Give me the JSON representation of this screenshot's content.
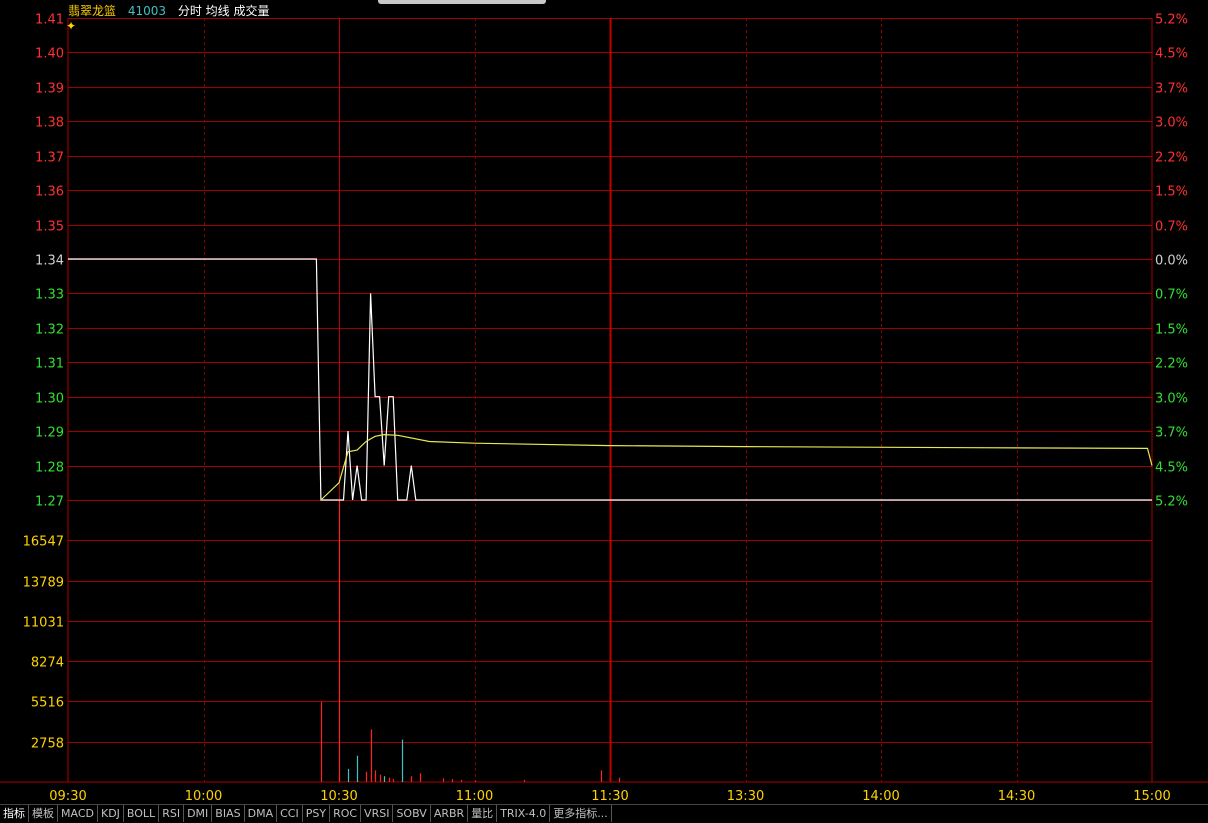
{
  "header": {
    "name": "翡翠龙篮",
    "code": "41003",
    "labels": "分时 均线 成交量",
    "name_color": "#ffd200",
    "code_color": "#40c0c0",
    "labels_color": "#ffffff"
  },
  "chart_data": {
    "type": "line",
    "price_axis": {
      "ticks": [
        "1.41",
        "1.40",
        "1.39",
        "1.38",
        "1.37",
        "1.36",
        "1.35",
        "1.34",
        "1.33",
        "1.32",
        "1.31",
        "1.30",
        "1.29",
        "1.28",
        "1.27"
      ],
      "ylim": [
        1.27,
        1.41
      ],
      "prev_close": 1.34
    },
    "pct_axis": {
      "ticks": [
        "5.2%",
        "4.5%",
        "3.7%",
        "3.0%",
        "2.2%",
        "1.5%",
        "0.7%",
        "0.0%",
        "0.7%",
        "1.5%",
        "2.2%",
        "3.0%",
        "3.7%",
        "4.5%",
        "5.2%"
      ]
    },
    "volume_axis": {
      "ticks": [
        "16547",
        "13789",
        "11031",
        "8274",
        "5516",
        "2758"
      ],
      "ylim": [
        0,
        19305
      ]
    },
    "time_ticks": [
      "09:30",
      "10:00",
      "10:30",
      "11:00",
      "11:30",
      "13:30",
      "14:00",
      "14:30",
      "15:00"
    ],
    "total_minutes": 240,
    "series": [
      {
        "key": "price",
        "color": "#ffffff",
        "points": [
          [
            0,
            1.34
          ],
          [
            55,
            1.34
          ],
          [
            56,
            1.27
          ],
          [
            60,
            1.27
          ],
          [
            61,
            1.27
          ],
          [
            62,
            1.29
          ],
          [
            63,
            1.27
          ],
          [
            64,
            1.28
          ],
          [
            65,
            1.27
          ],
          [
            66,
            1.27
          ],
          [
            67,
            1.33
          ],
          [
            68,
            1.3
          ],
          [
            69,
            1.3
          ],
          [
            70,
            1.28
          ],
          [
            71,
            1.3
          ],
          [
            72,
            1.3
          ],
          [
            73,
            1.27
          ],
          [
            75,
            1.27
          ],
          [
            76,
            1.28
          ],
          [
            77,
            1.27
          ],
          [
            240,
            1.27
          ]
        ]
      },
      {
        "key": "avg",
        "color": "#e8e850",
        "points": [
          [
            56,
            1.27
          ],
          [
            60,
            1.275
          ],
          [
            62,
            1.284
          ],
          [
            64,
            1.2845
          ],
          [
            66,
            1.287
          ],
          [
            68,
            1.2885
          ],
          [
            70,
            1.289
          ],
          [
            73,
            1.2888
          ],
          [
            80,
            1.287
          ],
          [
            90,
            1.2865
          ],
          [
            120,
            1.2858
          ],
          [
            150,
            1.2855
          ],
          [
            200,
            1.2852
          ],
          [
            239,
            1.285
          ],
          [
            240,
            1.28
          ]
        ]
      }
    ],
    "volume_bars": [
      {
        "x": 56,
        "v": 5500,
        "color": "#ff2020"
      },
      {
        "x": 60,
        "v": 19300,
        "color": "#ff2020"
      },
      {
        "x": 62,
        "v": 900,
        "color": "#40c0c0"
      },
      {
        "x": 64,
        "v": 1800,
        "color": "#40c0c0"
      },
      {
        "x": 66,
        "v": 700,
        "color": "#ff2020"
      },
      {
        "x": 67,
        "v": 3600,
        "color": "#ff2020"
      },
      {
        "x": 68,
        "v": 800,
        "color": "#ff2020"
      },
      {
        "x": 69,
        "v": 500,
        "color": "#ff2020"
      },
      {
        "x": 70,
        "v": 400,
        "color": "#40c0c0"
      },
      {
        "x": 71,
        "v": 300,
        "color": "#ff2020"
      },
      {
        "x": 72,
        "v": 200,
        "color": "#ff2020"
      },
      {
        "x": 74,
        "v": 2900,
        "color": "#40c0c0"
      },
      {
        "x": 76,
        "v": 400,
        "color": "#ff2020"
      },
      {
        "x": 78,
        "v": 600,
        "color": "#ff2020"
      },
      {
        "x": 83,
        "v": 250,
        "color": "#ff2020"
      },
      {
        "x": 85,
        "v": 200,
        "color": "#ff2020"
      },
      {
        "x": 87,
        "v": 150,
        "color": "#ff2020"
      },
      {
        "x": 90,
        "v": 100,
        "color": "#ff2020"
      },
      {
        "x": 101,
        "v": 150,
        "color": "#ff2020"
      },
      {
        "x": 118,
        "v": 800,
        "color": "#ff2020"
      },
      {
        "x": 122,
        "v": 300,
        "color": "#ff2020"
      }
    ]
  },
  "toolbar": {
    "tabs": [
      "指标",
      "模板",
      "MACD",
      "KDJ",
      "BOLL",
      "RSI",
      "DMI",
      "BIAS",
      "DMA",
      "CCI",
      "PSY",
      "ROC",
      "VRSI",
      "SOBV",
      "ARBR",
      "量比",
      "TRIX-4.0",
      "更多指标..."
    ]
  }
}
